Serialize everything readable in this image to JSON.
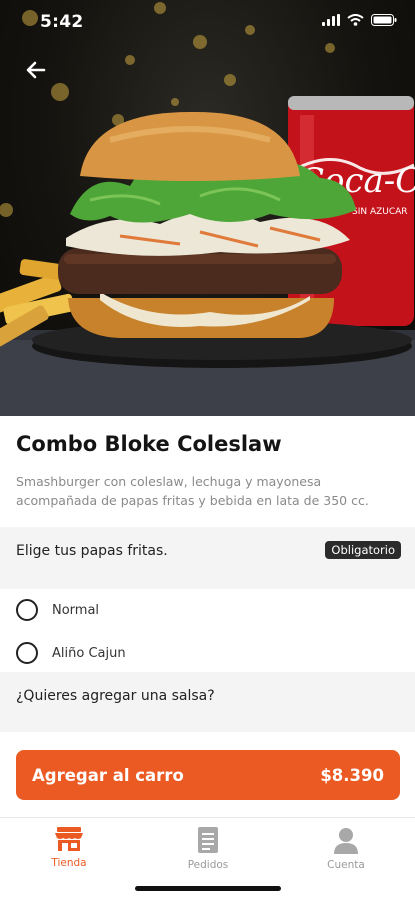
{
  "status_bar": {
    "time": "5:42"
  },
  "product": {
    "title": "Combo Bloke Coleslaw",
    "description": "Smashburger con coleslaw, lechuga y mayonesa  acompañada de papas fritas y bebida en lata de 350 cc."
  },
  "fries_section": {
    "label": "Elige tus papas fritas.",
    "badge": "Obligatorio",
    "options": [
      {
        "label": "Normal",
        "selected": false
      },
      {
        "label": "Aliño Cajun",
        "selected": false
      }
    ]
  },
  "sauce_section": {
    "label": "¿Quieres agregar una salsa?"
  },
  "cta": {
    "label": "Agregar al carro",
    "price": "$8.390"
  },
  "tabs": [
    {
      "label": "Tienda",
      "icon": "store-icon",
      "active": true
    },
    {
      "label": "Pedidos",
      "icon": "orders-icon",
      "active": false
    },
    {
      "label": "Cuenta",
      "icon": "account-icon",
      "active": false
    }
  ],
  "colors": {
    "accent": "#ec5a24",
    "badge_bg": "#2b2b2b",
    "section_bg": "#f4f4f4"
  },
  "hero_image": {
    "can_label": "Coca-Cola",
    "can_sublabel": "SIN AZUCAR"
  }
}
